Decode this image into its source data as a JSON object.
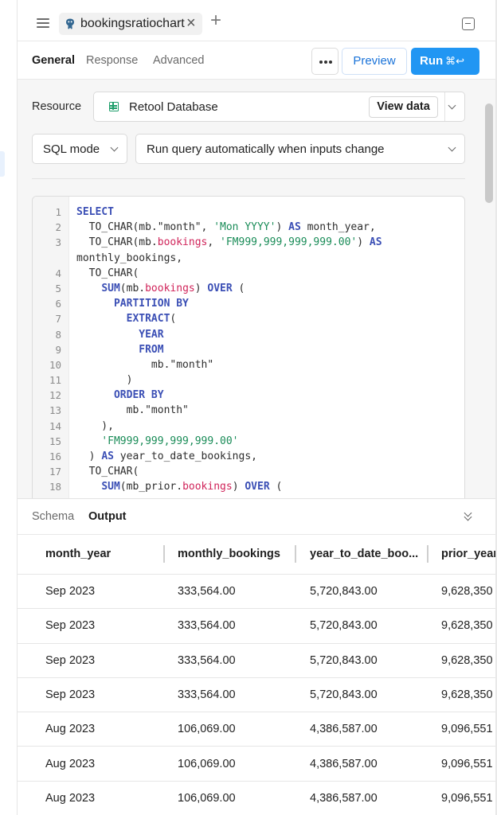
{
  "tab": {
    "title": "bookingsratiochart",
    "close": "×",
    "add": "+"
  },
  "subtabs": [
    "General",
    "Response",
    "Advanced"
  ],
  "toolbar": {
    "preview_label": "Preview",
    "run_label": "Run",
    "run_shortcut": "⌘↩"
  },
  "resource": {
    "label": "Resource",
    "name": "Retool Database",
    "view_data": "View data"
  },
  "mode": {
    "value": "SQL mode",
    "trigger": "Run query automatically when inputs change"
  },
  "code": {
    "lines": [
      {
        "n": "1",
        "html": "<span class=\"kw\">SELECT</span>"
      },
      {
        "n": "2",
        "html": "  TO_CHAR(mb.\"month\", <span class=\"st\">'Mon YYYY'</span>) <span class=\"kw\">AS</span> month_year,"
      },
      {
        "n": "3",
        "html": "  TO_CHAR(mb.<span class=\"pr\">bookings</span>, <span class=\"st\">'FM999,999,999,999.00'</span>) <span class=\"kw\">AS</span>"
      },
      {
        "n": "",
        "html": "monthly_bookings,"
      },
      {
        "n": "4",
        "html": "  TO_CHAR("
      },
      {
        "n": "5",
        "html": "    <span class=\"kw\">SUM</span>(mb.<span class=\"pr\">bookings</span>) <span class=\"kw\">OVER</span> ("
      },
      {
        "n": "6",
        "html": "      <span class=\"kw\">PARTITION BY</span>"
      },
      {
        "n": "7",
        "html": "        <span class=\"kw\">EXTRACT</span>("
      },
      {
        "n": "8",
        "html": "          <span class=\"kw\">YEAR</span>"
      },
      {
        "n": "9",
        "html": "          <span class=\"kw\">FROM</span>"
      },
      {
        "n": "10",
        "html": "            mb.\"month\""
      },
      {
        "n": "11",
        "html": "        )"
      },
      {
        "n": "12",
        "html": "      <span class=\"kw\">ORDER BY</span>"
      },
      {
        "n": "13",
        "html": "        mb.\"month\""
      },
      {
        "n": "14",
        "html": "    ),"
      },
      {
        "n": "15",
        "html": "    <span class=\"st\">'FM999,999,999,999.00'</span>"
      },
      {
        "n": "16",
        "html": "  ) <span class=\"kw\">AS</span> year_to_date_bookings,"
      },
      {
        "n": "17",
        "html": "  TO_CHAR("
      },
      {
        "n": "18",
        "html": "    <span class=\"kw\">SUM</span>(mb_prior.<span class=\"pr\">bookings</span>) <span class=\"kw\">OVER</span> ("
      }
    ]
  },
  "bottom_tabs": [
    "Schema",
    "Output"
  ],
  "table": {
    "columns": [
      "month_year",
      "monthly_bookings",
      "year_to_date_boo...",
      "prior_year"
    ],
    "rows": [
      [
        "Sep 2023",
        "333,564.00",
        "5,720,843.00",
        "9,628,350"
      ],
      [
        "Sep 2023",
        "333,564.00",
        "5,720,843.00",
        "9,628,350"
      ],
      [
        "Sep 2023",
        "333,564.00",
        "5,720,843.00",
        "9,628,350"
      ],
      [
        "Sep 2023",
        "333,564.00",
        "5,720,843.00",
        "9,628,350"
      ],
      [
        "Aug 2023",
        "106,069.00",
        "4,386,587.00",
        "9,096,551"
      ],
      [
        "Aug 2023",
        "106,069.00",
        "4,386,587.00",
        "9,096,551"
      ],
      [
        "Aug 2023",
        "106,069.00",
        "4,386,587.00",
        "9,096,551"
      ]
    ]
  },
  "colors": {
    "accent": "#2196f3",
    "keyword": "#3b4fb5",
    "string": "#1a8c58",
    "property": "#d0245a",
    "db_icon": "#1e9e6a"
  }
}
